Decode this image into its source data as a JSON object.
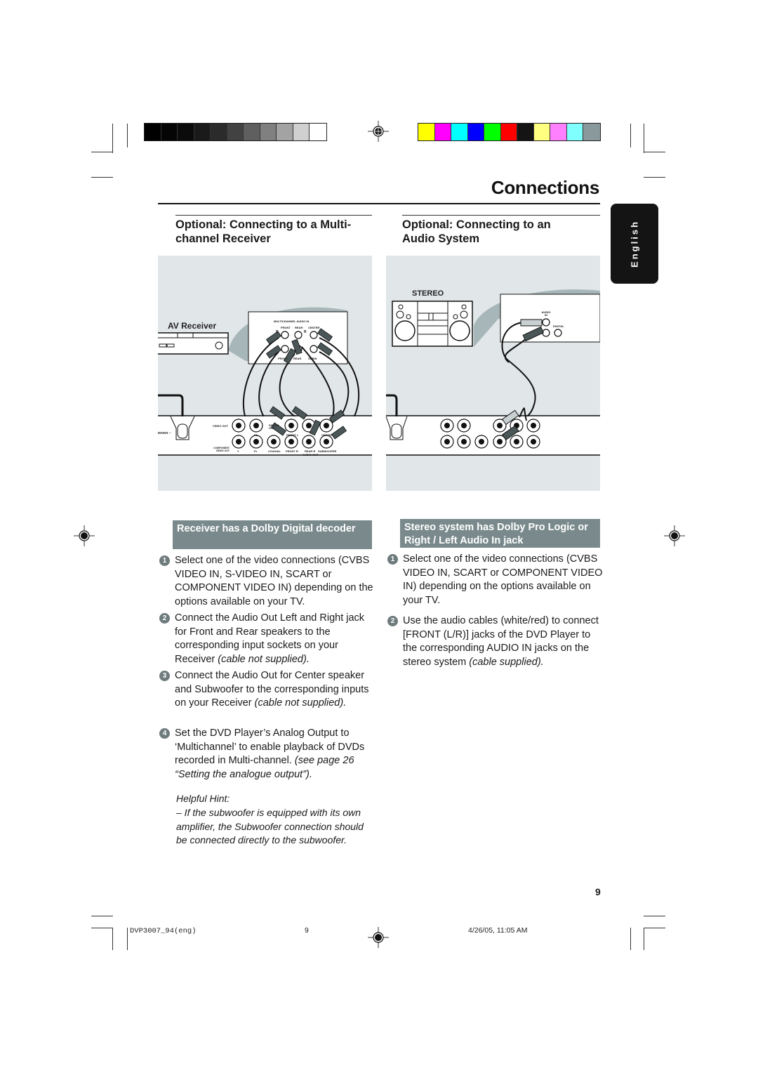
{
  "print_marks": {
    "grayscale_swatches": [
      "#000000",
      "#050505",
      "#0b0b0b",
      "#1a1a1a",
      "#2b2b2b",
      "#424242",
      "#5f5f5f",
      "#808080",
      "#a3a3a3",
      "#d0d0d0",
      "#ffffff"
    ],
    "color_swatches": [
      "#ffff00",
      "#ff00ff",
      "#00ffff",
      "#0000ff",
      "#00ff00",
      "#ff0000",
      "#141414",
      "#ffff80",
      "#ff80ff",
      "#80ffff",
      "#8a9a9c"
    ]
  },
  "header": {
    "title": "Connections",
    "language_tab": "English"
  },
  "left_section": {
    "heading_line1": "Optional: Connecting to a Multi-",
    "heading_line2": "channel Receiver",
    "diagram": {
      "device_label": "AV Receiver",
      "panel_title": "MULTICHANNEL AUDIO IN",
      "panel_columns": [
        "FRONT",
        "REAR",
        "CENTER"
      ],
      "panel_side_labels": [
        "R",
        "R"
      ],
      "panel_bottom_labels": [
        "FRONT",
        "REAR",
        "SUBW."
      ],
      "player_labels": {
        "mains": "MAINS ~",
        "video_out": "VIDEO OUT",
        "component": "COMPONENT VIDEO OUT",
        "pb": "Pb",
        "y": "Y",
        "pr": "Pr",
        "digital_out": "DIGITAL OUT",
        "coaxial": "COAXIAL",
        "front_l": "FRONT L",
        "front_r": "FRONT R",
        "rear_l": "REAR L",
        "rear_r": "REAR R",
        "center": "CENTER",
        "subwoofer": "SUBWOOFER",
        "audio_out": "AUDIO OUT"
      }
    },
    "subheading": "Receiver has a Dolby Digital decoder",
    "steps": [
      {
        "num": "1",
        "text": "Select one of the video connections (CVBS VIDEO IN, S-VIDEO IN, SCART or COMPONENT VIDEO IN) depending on the options available on your TV.",
        "note": ""
      },
      {
        "num": "2",
        "text": "Connect the Audio Out Left and Right jack for Front and Rear speakers to the corresponding input sockets on your Receiver ",
        "note": "(cable not supplied)."
      },
      {
        "num": "3",
        "text": "Connect the Audio Out for Center speaker and Subwoofer to the corresponding inputs on your Receiver ",
        "note": "(cable not supplied)."
      },
      {
        "num": "4",
        "text": "Set the DVD Player’s Analog Output to ‘Multichannel’ to enable playback of DVDs recorded in Multi-channel. ",
        "note": "(see page 26 “Setting the analogue output”)."
      }
    ],
    "hint_title": "Helpful Hint:",
    "hint_text": "–    If the subwoofer is equipped with its own amplifier, the Subwoofer connection should be connected directly to the subwoofer."
  },
  "right_section": {
    "heading_line1": "Optional: Connecting to an",
    "heading_line2": "Audio System",
    "diagram": {
      "device_label": "STEREO",
      "panel_audio_in": "AUDIO IN",
      "panel_digital": "DIGITAL"
    },
    "subheading": "Stereo system has Dolby Pro Logic or Right / Left Audio In jack",
    "steps": [
      {
        "num": "1",
        "text": "Select one of the video connections (CVBS VIDEO IN, SCART or COMPONENT VIDEO IN) depending on the options available on your TV.",
        "note": ""
      },
      {
        "num": "2",
        "text": "Use the audio cables (white/red) to connect [FRONT (L/R)] jacks of the DVD Player to the corresponding AUDIO IN jacks on the stereo system ",
        "note": "(cable supplied)."
      }
    ]
  },
  "page_number": "9",
  "footer": {
    "file": "DVP3007_94(eng)",
    "page": "9",
    "timestamp": "4/26/05, 11:05 AM"
  }
}
